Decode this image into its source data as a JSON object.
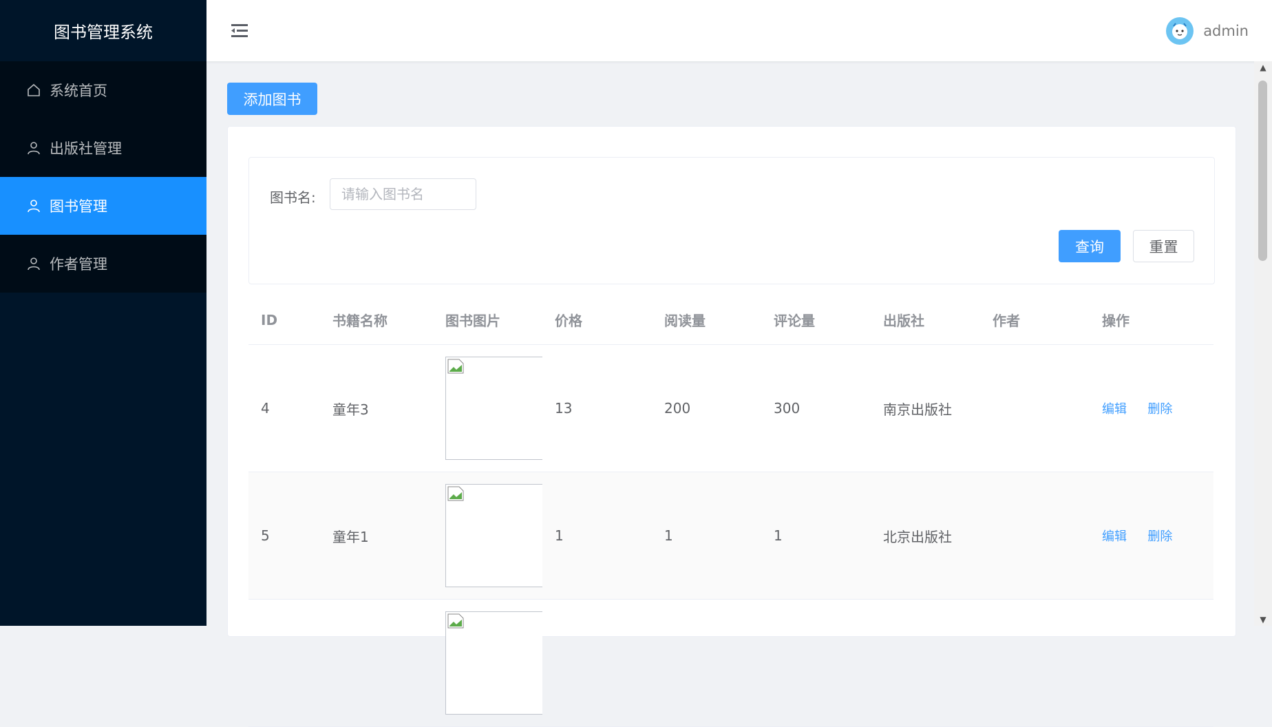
{
  "sidebar": {
    "brand": "图书管理系统",
    "items": [
      {
        "label": "系统首页",
        "icon": "home-icon",
        "active": false
      },
      {
        "label": "出版社管理",
        "icon": "user-icon",
        "active": false
      },
      {
        "label": "图书管理",
        "icon": "user-icon",
        "active": true
      },
      {
        "label": "作者管理",
        "icon": "user-icon",
        "active": false
      }
    ],
    "colors": {
      "background": "#001529",
      "active": "#1890ff"
    }
  },
  "header": {
    "username": "admin"
  },
  "toolbar": {
    "add_label": "添加图书"
  },
  "search": {
    "label": "图书名:",
    "placeholder": "请输入图书名",
    "value": "",
    "query_label": "查询",
    "reset_label": "重置"
  },
  "table": {
    "columns": [
      "ID",
      "书籍名称",
      "图书图片",
      "价格",
      "阅读量",
      "评论量",
      "出版社",
      "作者",
      "操作"
    ],
    "rows": [
      {
        "id": "4",
        "name": "童年3",
        "price": "13",
        "reads": "200",
        "comments": "300",
        "publisher": "南京出版社",
        "author": "",
        "edit": "编辑",
        "delete": "删除"
      },
      {
        "id": "5",
        "name": "童年1",
        "price": "1",
        "reads": "1",
        "comments": "1",
        "publisher": "北京出版社",
        "author": "",
        "edit": "编辑",
        "delete": "删除"
      }
    ]
  },
  "colors": {
    "primary": "#409eff",
    "page_bg": "#f0f2f5"
  }
}
